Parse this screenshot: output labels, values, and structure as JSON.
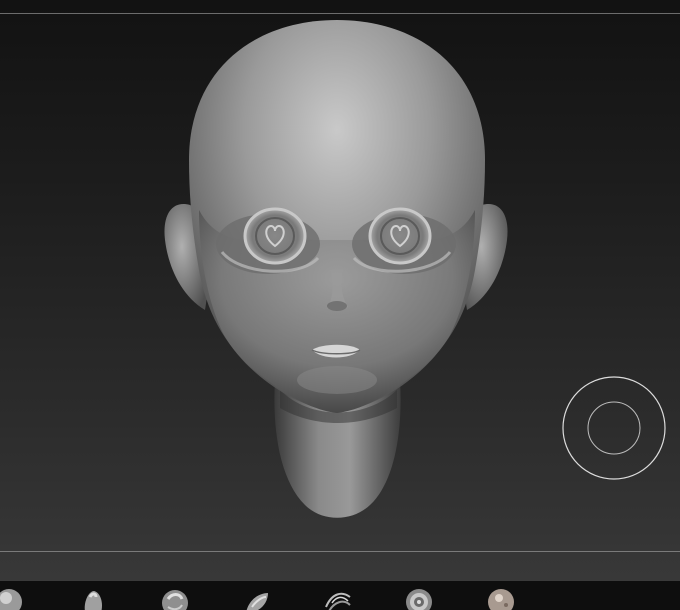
{
  "viewport": {
    "background_top": "#121212",
    "background_bottom": "#383838",
    "content": "sculpt-head-model"
  },
  "navigation": {
    "gizmo": "rotate-gizmo-icon"
  },
  "shelf": {
    "brushes": [
      {
        "icon": "clay-brush-icon"
      },
      {
        "icon": "standard-brush-icon"
      },
      {
        "icon": "inflate-brush-icon"
      },
      {
        "icon": "move-brush-icon"
      },
      {
        "icon": "hair-curve-brush-icon"
      },
      {
        "icon": "spiral-brush-icon"
      },
      {
        "icon": "alpha-sphere-brush-icon"
      }
    ]
  },
  "colors": {
    "model_light": "#cfcfcf",
    "model_mid": "#8c8c8c",
    "model_dark": "#3a3a3a",
    "gizmo_stroke": "#dcdcdc"
  }
}
